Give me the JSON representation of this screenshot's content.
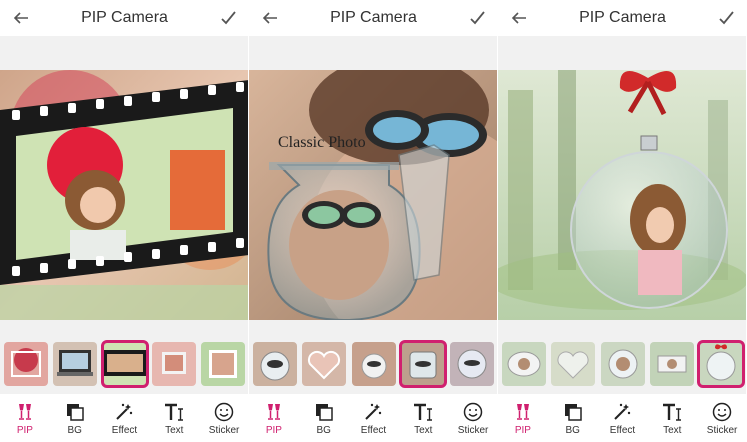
{
  "app": {
    "title": "PIP Camera"
  },
  "screens": [
    {
      "title": "PIP Camera",
      "overlay_text": ""
    },
    {
      "title": "PIP Camera",
      "overlay_text": "Classic Photo"
    },
    {
      "title": "PIP Camera",
      "overlay_text": ""
    }
  ],
  "toolbar": {
    "items": [
      {
        "label": "PIP",
        "icon": "pip-icon"
      },
      {
        "label": "BG",
        "icon": "bg-icon"
      },
      {
        "label": "Effect",
        "icon": "effect-icon"
      },
      {
        "label": "Text",
        "icon": "text-icon"
      },
      {
        "label": "Sticker",
        "icon": "sticker-icon"
      }
    ],
    "active": "PIP"
  },
  "thumbs": {
    "screen1_selected_index": 2,
    "screen2_selected_index": 3,
    "screen3_selected_index": 4
  },
  "colors": {
    "accent": "#d0206f",
    "toolbar_bg": "#ffffff",
    "panel_bg": "#f1f1f1"
  }
}
